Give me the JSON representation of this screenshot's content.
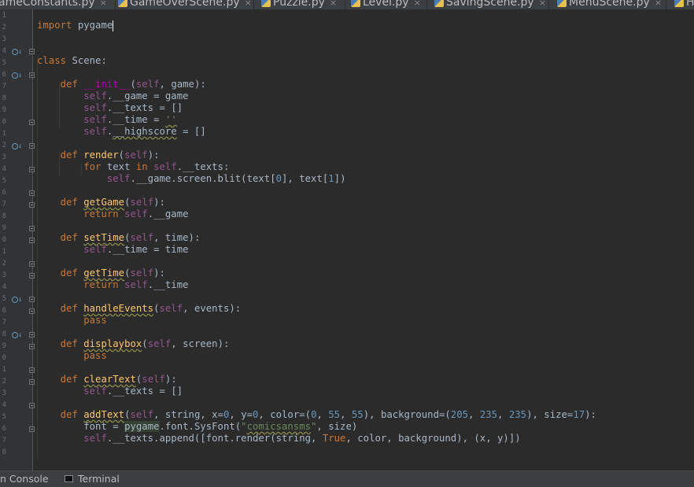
{
  "tabs": [
    {
      "label": "ameConstants.py"
    },
    {
      "label": "GameOverScene.py"
    },
    {
      "label": "Puzzle.py"
    },
    {
      "label": "Level.py"
    },
    {
      "label": "SavingScene.py"
    },
    {
      "label": "MenuScene.py"
    },
    {
      "label": "H"
    }
  ],
  "tab_close_glyph": "×",
  "gutter": {
    "line_numbers": [
      "1",
      "2",
      "3",
      "4",
      "5",
      "6",
      "7",
      "8",
      "9",
      "0",
      "1",
      "2",
      "3",
      "4",
      "5",
      "6",
      "7",
      "8",
      "9",
      "0",
      "1",
      "2",
      "3",
      "4",
      "5",
      "6",
      "7",
      "8",
      "9",
      "0",
      "1",
      "2",
      "3",
      "4",
      "5",
      "6",
      "7",
      "8"
    ],
    "override_glyph": "↓"
  },
  "editor": {
    "language": "python",
    "caret_line": 1,
    "lines": [
      "import pygame",
      "",
      "",
      "class Scene:",
      "",
      "    def __init__(self, game):",
      "        self.__game = game",
      "        self.__texts = []",
      "        self.__time = ''",
      "        self.__highscore = []",
      "",
      "    def render(self):",
      "        for text in self.__texts:",
      "            self.__game.screen.blit(text[0], text[1])",
      "",
      "    def getGame(self):",
      "        return self.__game",
      "",
      "    def setTime(self, time):",
      "        self.__time = time",
      "",
      "    def getTime(self):",
      "        return self.__time",
      "",
      "    def handleEvents(self, events):",
      "        pass",
      "",
      "    def displaybox(self, screen):",
      "        pass",
      "",
      "    def clearText(self):",
      "        self.__texts = []",
      "",
      "    def addText(self, string, x=0, y=0, color=(0, 55, 55), background=(205, 235, 235), size=17):",
      "        font = pygame.font.SysFont(\"comicsansms\", size)",
      "        self.__texts.append([font.render(string, True, color, background), (x, y)])",
      "",
      ""
    ]
  },
  "bottom": {
    "run_console_label": "n Console",
    "terminal_label": "Terminal"
  },
  "colors": {
    "background": "#2b2b2b",
    "keyword": "#cc7832",
    "self": "#94558d",
    "number": "#6897bb",
    "string": "#6a8759",
    "function": "#ffc66d",
    "magic": "#b200b2",
    "text": "#a9b7c6"
  }
}
